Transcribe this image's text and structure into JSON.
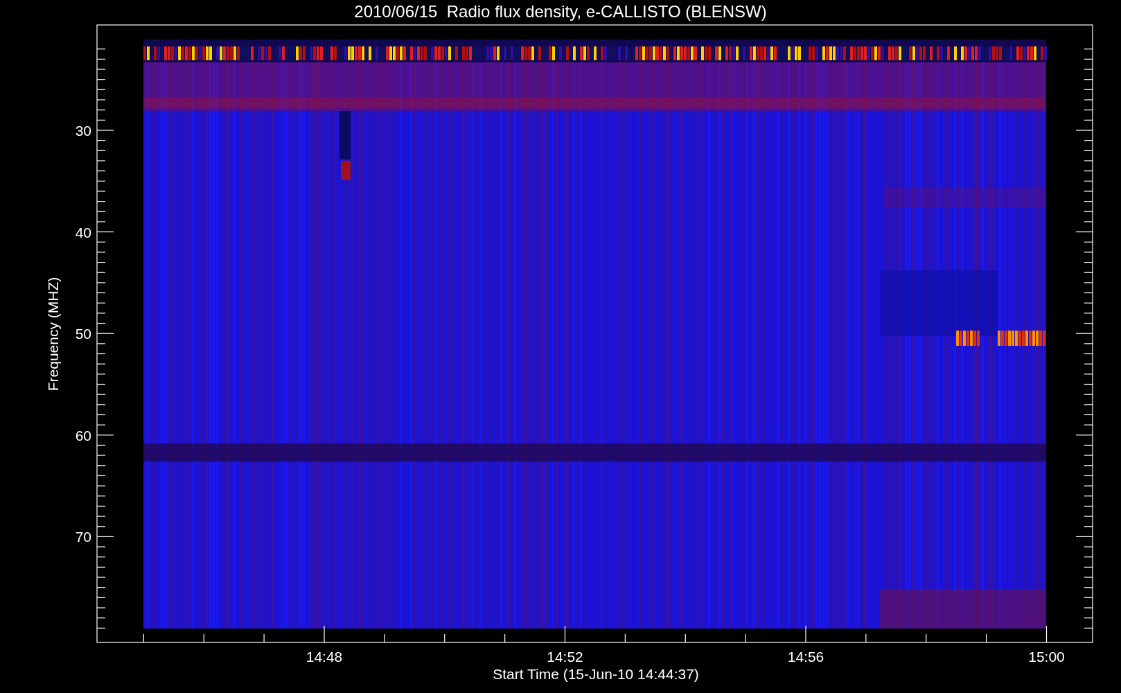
{
  "title": "2010/06/15  Radio flux density, e-CALLISTO (BLENSW)",
  "y_axis": {
    "label": "Frequency (MHZ)",
    "ticks": [
      "30",
      "40",
      "50",
      "60",
      "70"
    ]
  },
  "x_axis": {
    "label": "Start Time (15-Jun-10 14:44:37)",
    "ticks": [
      "14:48",
      "14:52",
      "14:56",
      "15:00"
    ]
  }
}
